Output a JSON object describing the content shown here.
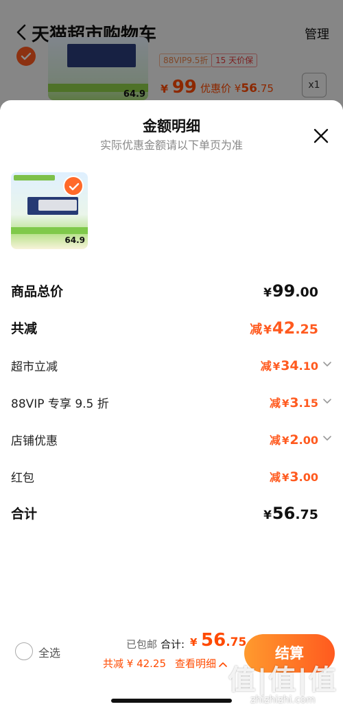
{
  "background_page": {
    "title": "天猫超市购物车",
    "manage_label": "管理",
    "item": {
      "thumb_price": "64.9",
      "tag_vip": "88VIP9.5折",
      "tag_price_protect": "15 天价保",
      "price_currency": "¥",
      "price": "99",
      "promo_label": "优惠价",
      "promo_currency": "¥",
      "promo_int": "56",
      "promo_dec": ".75",
      "quantity": "x1"
    }
  },
  "sheet": {
    "title": "金额明细",
    "subtitle": "实际优惠金额请以下单页为准",
    "product_thumb_price": "64.9",
    "rows": {
      "total_price": {
        "label": "商品总价",
        "currency": "¥",
        "int": "99",
        "dec": ".00"
      },
      "total_reduction": {
        "label": "共减",
        "prefix": "减",
        "currency": "¥",
        "int": "42",
        "dec": ".25"
      },
      "supermarket_reduction": {
        "label": "超市立减",
        "prefix": "减",
        "currency": "¥",
        "int": "34",
        "dec": ".10"
      },
      "vip_discount": {
        "label": "88VIP 专享 9.5 折",
        "prefix": "减",
        "currency": "¥",
        "int": "3",
        "dec": ".15"
      },
      "store_discount": {
        "label": "店铺优惠",
        "prefix": "减",
        "currency": "¥",
        "int": "2",
        "dec": ".00"
      },
      "red_packet": {
        "label": "红包",
        "prefix": "减",
        "currency": "¥",
        "int": "3",
        "dec": ".00"
      },
      "subtotal": {
        "label": "合计",
        "currency": "¥",
        "int": "56",
        "dec": ".75"
      }
    }
  },
  "bottom_bar": {
    "select_all": "全选",
    "shipping": "已包邮",
    "total_label": "合计:",
    "total_currency": "¥",
    "total_int": "56",
    "total_dec": ".75",
    "savings": "共减 ¥ 42.25",
    "detail_link": "查看明细",
    "checkout": "结算"
  },
  "watermark": {
    "logo": "值|值|值",
    "url": "zhizhizhi.com"
  },
  "colors": {
    "accent": "#ff5a1f",
    "checkout_gradient_start": "#ff9a2e",
    "checkout_gradient_end": "#ff5a1f"
  }
}
